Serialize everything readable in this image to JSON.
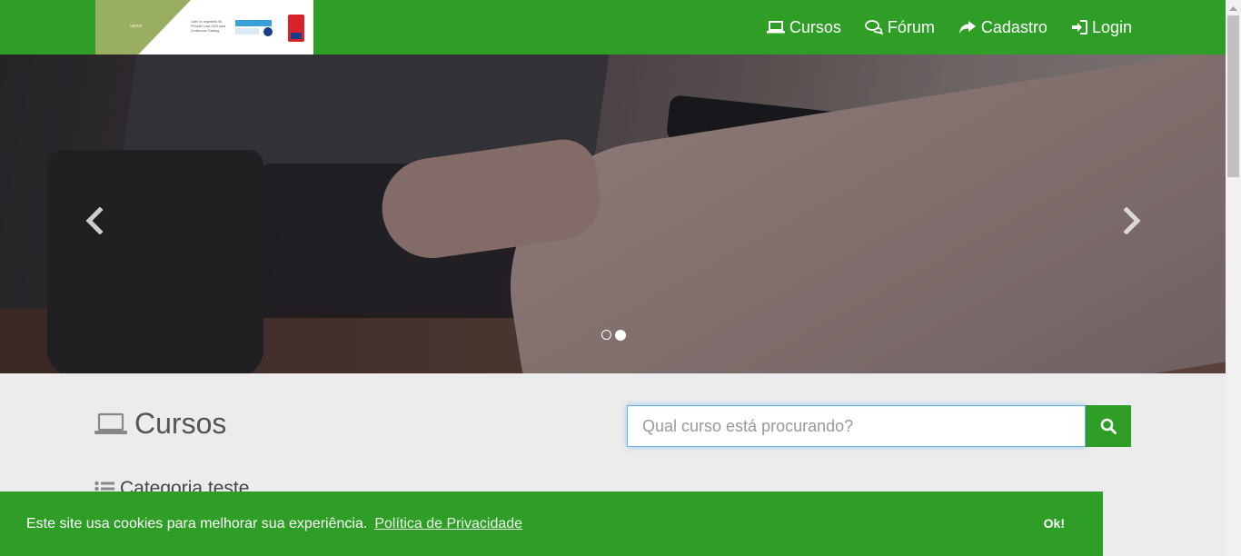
{
  "brand": {
    "logo_alt": "Logo",
    "logo_mark": "yamer",
    "logo_tagline": "Líder no segmento Sit Provider Loss 2020 para Continuous Training"
  },
  "nav": {
    "items": [
      {
        "label": "Cursos",
        "icon": "laptop-icon"
      },
      {
        "label": "Fórum",
        "icon": "comments-icon"
      },
      {
        "label": "Cadastro",
        "icon": "share-icon"
      },
      {
        "label": "Login",
        "icon": "sign-in-icon"
      }
    ]
  },
  "carousel": {
    "prev_label": "Previous",
    "next_label": "Next",
    "slide_count": 2,
    "active_index": 1
  },
  "courses": {
    "title": "Cursos",
    "search_placeholder": "Qual curso está procurando?",
    "search_value": "",
    "category": "Categoria teste"
  },
  "cookie": {
    "message": "Este site usa cookies para melhorar sua experiência.",
    "link_text": "Política de Privacidade",
    "ok_label": "Ok!"
  },
  "colors": {
    "primary": "#2e9e26",
    "text": "#555555",
    "background": "#ececec"
  }
}
